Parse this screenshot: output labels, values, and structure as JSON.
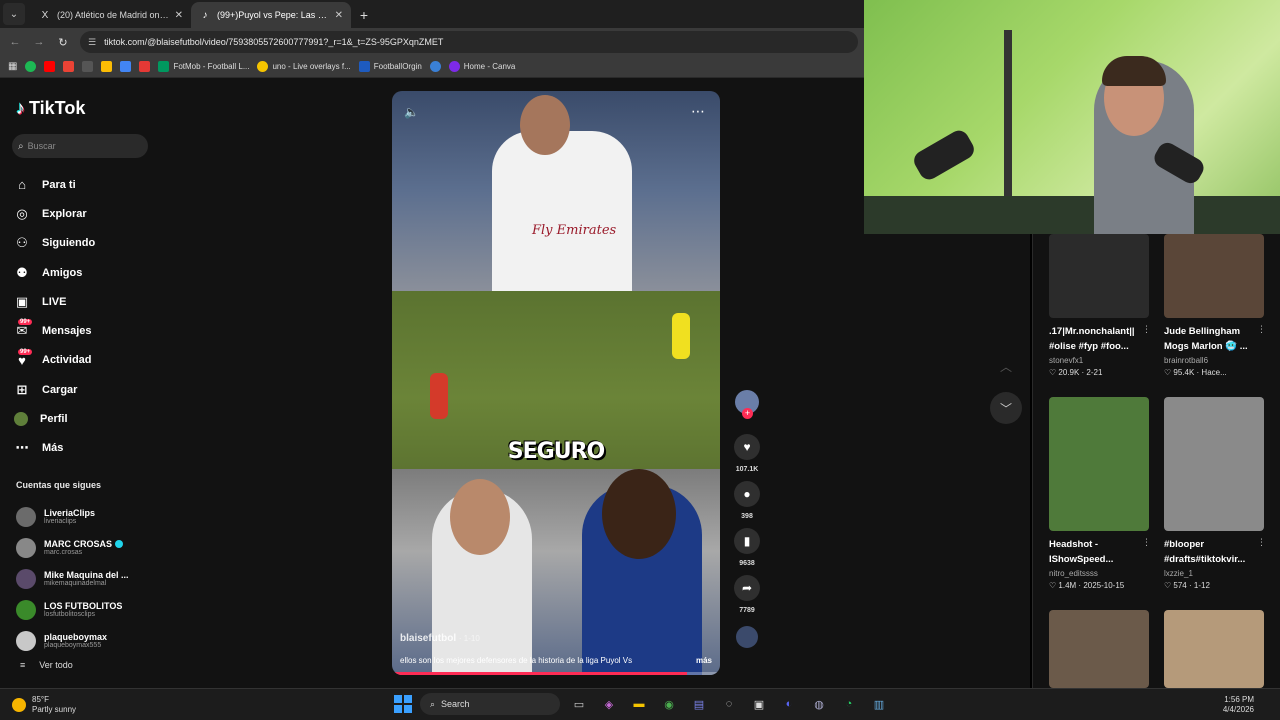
{
  "browser": {
    "tabs": [
      {
        "favicon": "X",
        "title": "(20) Atlético de Madrid on X: \"R",
        "close": "✕"
      },
      {
        "favicon": "♪",
        "title": "(99+)Puyol vs Pepe: Las Mejores",
        "close": "✕"
      }
    ],
    "url": "tiktok.com/@blaisefutbol/video/7593805572600777991?_r=1&_t=ZS-95GPXqnZMET",
    "bookmarks": [
      "FotMob - Football L...",
      "uno - Live overlays f...",
      "FootballOrgin",
      "Home - Canva"
    ]
  },
  "sidebar": {
    "brand": "TikTok",
    "search_placeholder": "Buscar",
    "nav": [
      {
        "label": "Para ti",
        "icon": "home-icon"
      },
      {
        "label": "Explorar",
        "icon": "compass-icon"
      },
      {
        "label": "Siguiendo",
        "icon": "following-icon"
      },
      {
        "label": "Amigos",
        "icon": "friends-icon"
      },
      {
        "label": "LIVE",
        "icon": "live-icon"
      },
      {
        "label": "Mensajes",
        "icon": "messages-icon",
        "badge": "99+"
      },
      {
        "label": "Actividad",
        "icon": "activity-icon",
        "badge": "99+"
      },
      {
        "label": "Cargar",
        "icon": "upload-icon"
      },
      {
        "label": "Perfil",
        "icon": "profile-icon"
      },
      {
        "label": "Más",
        "icon": "more-icon"
      }
    ],
    "following_title": "Cuentas que sigues",
    "following": [
      {
        "name": "LiveriaClips",
        "handle": "liveriaclips",
        "color": "#6b6b6b"
      },
      {
        "name": "MARC CROSAS",
        "handle": "marc.crosas",
        "color": "#888888",
        "verified": true
      },
      {
        "name": "Mike Maquina del ...",
        "handle": "mikemaquinadelmal",
        "color": "#5a4a6a"
      },
      {
        "name": "LOS FUTBOLITOS",
        "handle": "losfutbolitosclips",
        "color": "#3a8a2a"
      },
      {
        "name": "plaqueboymax",
        "handle": "plaqueboymax555",
        "color": "#c8c8c8"
      }
    ],
    "see_all": "Ver todo"
  },
  "video": {
    "caption": "SEGURO",
    "shirt_text": "Fly Emirates",
    "author": "blaisefutbol",
    "author_suffix": "· 1-10",
    "description": "ellos son los mejores defensores de la historia de la liga Puyol Vs",
    "more": "más",
    "progress": 0.9,
    "likes": "107.1K",
    "comments": "398",
    "saves": "9638",
    "shares": "7789"
  },
  "suggested": [
    {
      "title": ".17|Mr.nonchalant|| #olise #fyp #foo...",
      "author": "stonevfx1",
      "likes": "20.9K",
      "date": "2-21",
      "color": "#2b2b2b"
    },
    {
      "title": "Jude Bellingham Mogs Marlon 🥶 ...",
      "author": "brainrotball6",
      "likes": "95.4K",
      "date": "Hace...",
      "color": "#5a4638"
    },
    {
      "title": "Headshot - IShowSpeed...",
      "author": "nitro_editssss",
      "likes": "1.4M",
      "date": "2025-10-15",
      "color": "#4f7a3a"
    },
    {
      "title": "#blooper #drafts#tiktokvir...",
      "author": "lxzzie_1",
      "likes": "574",
      "date": "1-12",
      "color": "#8a8a8a"
    },
    {
      "title": "",
      "author": "",
      "likes": "",
      "date": "",
      "color": "#6b5a4a"
    },
    {
      "title": "",
      "author": "",
      "likes": "",
      "date": "",
      "color": "#b59a7a"
    }
  ],
  "taskbar": {
    "temp": "85°F",
    "weather": "Partly sunny",
    "search": "Search",
    "time": "1:56 PM",
    "date": "4/4/2026"
  }
}
